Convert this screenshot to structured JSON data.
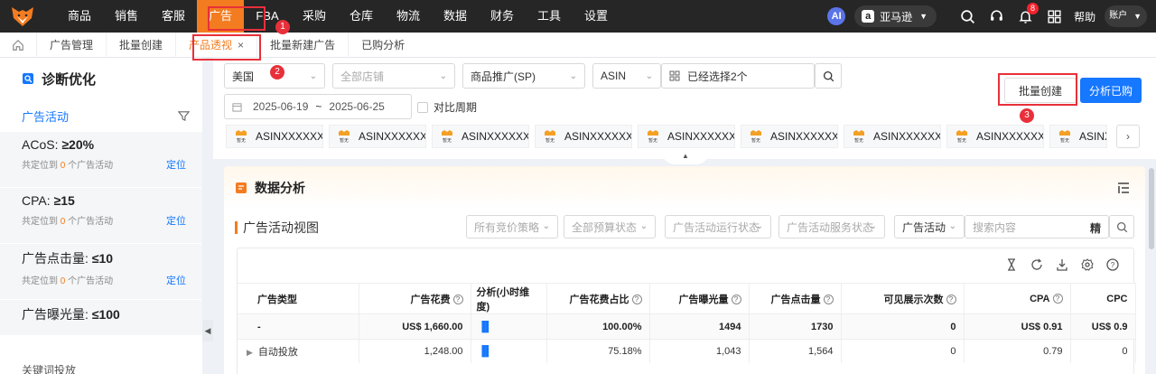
{
  "topnav": {
    "items": [
      "商品",
      "销售",
      "客服",
      "广告",
      "FBA",
      "采购",
      "仓库",
      "物流",
      "数据",
      "财务",
      "工具",
      "设置"
    ],
    "active_index": 3,
    "ai_label": "AI",
    "site_icon": "a",
    "site_label": "亚马逊",
    "bell_count": "8",
    "help_label": "帮助",
    "account_label": "账户"
  },
  "tabs": {
    "items": [
      "广告管理",
      "批量创建",
      "产品透视",
      "批量新建广告",
      "已购分析"
    ],
    "active_index": 2,
    "close": "×"
  },
  "annotations": [
    "1",
    "2",
    "3"
  ],
  "sidebar": {
    "title": "诊断优化",
    "section": "广告活动",
    "items": [
      {
        "label": "ACoS: ",
        "value": "≥20%",
        "prefix": "共定位到",
        "count": "0",
        "suffix": "个广告活动",
        "action": "定位"
      },
      {
        "label": "CPA: ",
        "value": "≥15",
        "prefix": "共定位到",
        "count": "0",
        "suffix": "个广告活动",
        "action": "定位"
      },
      {
        "label": "广告点击量: ",
        "value": "≤10",
        "prefix": "共定位到",
        "count": "0",
        "suffix": "个广告活动",
        "action": "定位"
      },
      {
        "label": "广告曝光量: ",
        "value": "≤100"
      }
    ],
    "keyword_section": "关键词投放"
  },
  "filters": {
    "country": "美国",
    "store_placeholder": "全部店铺",
    "ad_type": "商品推广(SP)",
    "id_type": "ASIN",
    "selected": "已经选择2个",
    "date_start": "2025-06-19",
    "date_sep": "~",
    "date_end": "2025-06-25",
    "compare_label": "对比周期",
    "batch_create": "批量创建",
    "analyze_purchased": "分析已购",
    "asins": [
      "ASINXXXXXX",
      "ASINXXXXXX",
      "ASINXXXXXX",
      "ASINXXXXXX",
      "ASINXXXXXX",
      "ASINXXXXXX",
      "ASINXXXXXX",
      "ASINXXXXXX",
      "ASINXXXXXX"
    ],
    "asin_thumb_label": "暂无"
  },
  "panel": {
    "title": "数据分析",
    "view_title": "广告活动视图",
    "filter_placeholders": [
      "所有竞价策略",
      "全部预算状态",
      "广告活动运行状态",
      "广告活动服务状态"
    ],
    "search_scope": "广告活动",
    "search_placeholder": "搜索内容",
    "search_mode": "精"
  },
  "table": {
    "headers": [
      "广告类型",
      "广告花费",
      "分析(小时维度)",
      "广告花费占比",
      "广告曝光量",
      "广告点击量",
      "可见展示次数",
      "CPA",
      "CPC"
    ],
    "help_mark": "?",
    "rows": [
      [
        "-",
        "US$ 1,660.00",
        "",
        "100.00%",
        "1494",
        "1730",
        "0",
        "US$ 0.91",
        "US$ 0.9"
      ],
      [
        "自动投放",
        "1,248.00",
        "",
        "75.18%",
        "1,043",
        "1,564",
        "0",
        "0.79",
        "0"
      ]
    ]
  }
}
